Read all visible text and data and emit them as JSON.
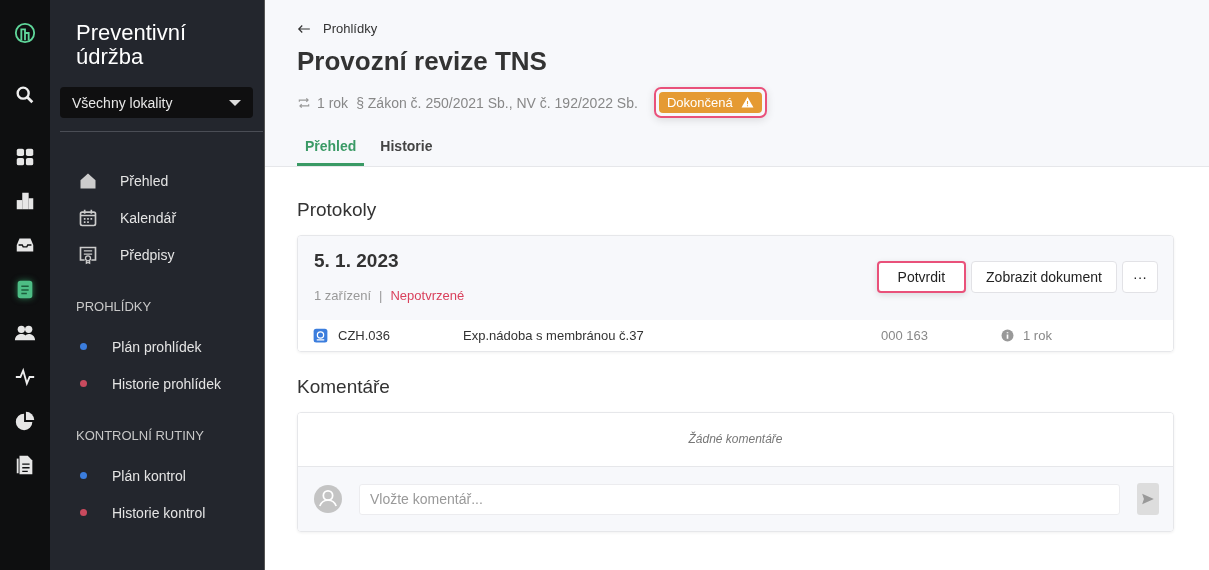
{
  "rail": [
    {
      "kind": "logo",
      "selected": false
    },
    {
      "kind": "search",
      "selected": false
    },
    {
      "kind": "grid",
      "selected": false
    },
    {
      "kind": "buildings",
      "selected": false
    },
    {
      "kind": "inbox",
      "selected": false
    },
    {
      "kind": "clipboard",
      "selected": true
    },
    {
      "kind": "users",
      "selected": false
    },
    {
      "kind": "pulse",
      "selected": false
    },
    {
      "kind": "pie",
      "selected": false
    },
    {
      "kind": "document",
      "selected": false
    }
  ],
  "sidebar": {
    "title": "Preventivní údržba",
    "location_select": "Všechny lokality",
    "items": [
      {
        "kind": "home",
        "label": "Přehled"
      },
      {
        "kind": "calendar",
        "label": "Kalendář"
      },
      {
        "kind": "certificate",
        "label": "Předpisy"
      }
    ],
    "sections": [
      {
        "heading": "PROHLÍDKY",
        "items": [
          {
            "label": "Plán prohlídek",
            "color": "#3b7ddd"
          },
          {
            "label": "Historie prohlídek",
            "color": "#c94a5e"
          }
        ]
      },
      {
        "heading": "KONTROLNÍ RUTINY",
        "items": [
          {
            "label": "Plán kontrol",
            "color": "#3b7ddd"
          },
          {
            "label": "Historie kontrol",
            "color": "#c94a5e"
          }
        ]
      }
    ]
  },
  "header": {
    "back_link": "Prohlídky",
    "title": "Provozní revize TNS",
    "interval": "1 rok",
    "legislation": "§ Zákon č. 250/2021 Sb., NV č. 192/2022 Sb.",
    "status": {
      "label": "Dokončená",
      "warning": true,
      "highlighted": true
    }
  },
  "tabs": [
    {
      "label": "Přehled",
      "selected": true
    },
    {
      "label": "Historie",
      "selected": false
    }
  ],
  "protocols": {
    "heading": "Protokoly",
    "cards": [
      {
        "date": "5. 1. 2023",
        "devices": "1 zařízení",
        "separator": "|",
        "state": "Nepotvrzené",
        "confirm": {
          "label": "Potvrdit",
          "highlighted": true
        },
        "view_button": "Zobrazit dokument",
        "more_button": "···",
        "rows": [
          {
            "code": "CZH.036",
            "name": "Exp.nádoba s membránou č.37",
            "number": "000 163",
            "interval": "1 rok"
          }
        ]
      }
    ]
  },
  "comments": {
    "heading": "Komentáře",
    "empty": "Žádné komentáře",
    "input": {
      "placeholder": "Vložte komentář..."
    }
  }
}
